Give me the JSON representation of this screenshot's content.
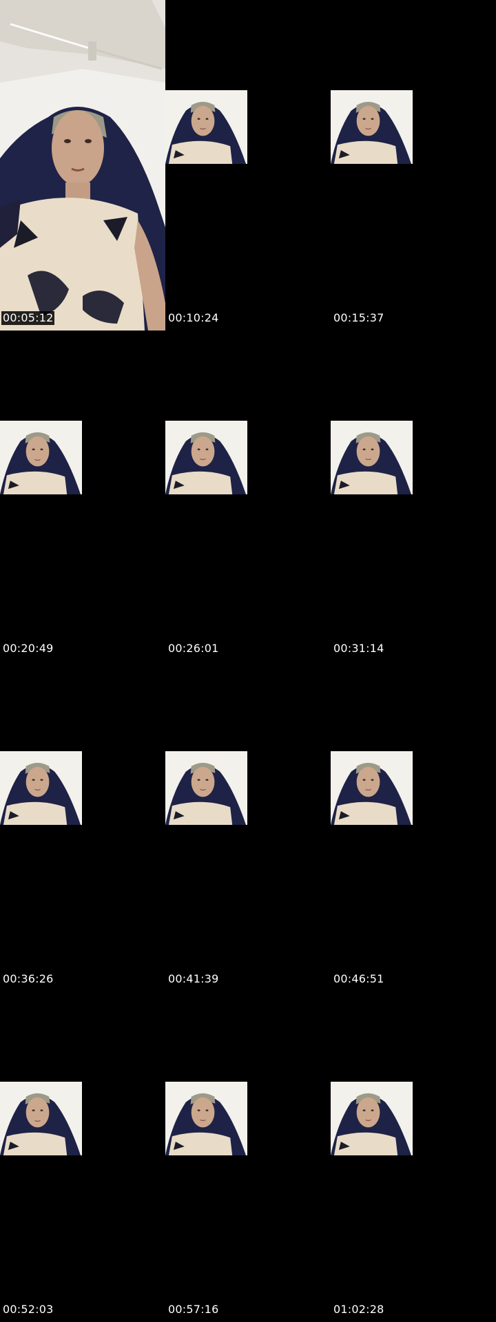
{
  "contact_sheet": {
    "background_color": "#000000",
    "timestamp_color": "#ffffff",
    "frames": [
      {
        "timestamp": "00:05:12"
      },
      {
        "timestamp": "00:10:24"
      },
      {
        "timestamp": "00:15:37"
      },
      {
        "timestamp": "00:20:49"
      },
      {
        "timestamp": "00:26:01"
      },
      {
        "timestamp": "00:31:14"
      },
      {
        "timestamp": "00:36:26"
      },
      {
        "timestamp": "00:41:39"
      },
      {
        "timestamp": "00:46:51"
      },
      {
        "timestamp": "00:52:03"
      },
      {
        "timestamp": "00:57:16"
      },
      {
        "timestamp": "01:02:28"
      }
    ]
  }
}
